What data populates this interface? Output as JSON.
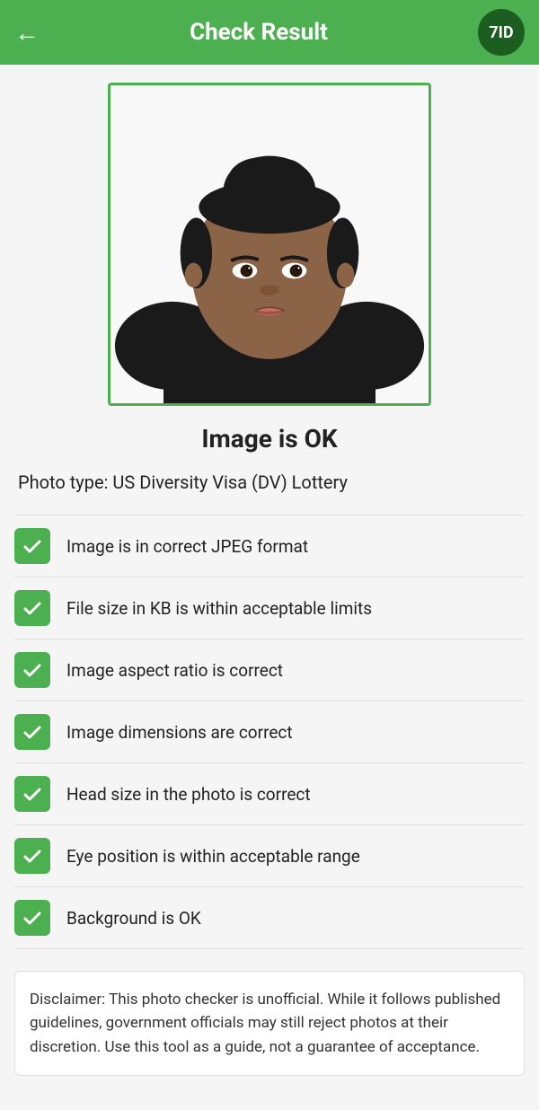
{
  "header": {
    "title": "Check Result",
    "back_icon": "←",
    "logo_text": "7ID"
  },
  "status": {
    "label": "Image is OK"
  },
  "photo_type": {
    "label": "Photo type: US Diversity Visa (DV) Lottery"
  },
  "checks": [
    {
      "id": 1,
      "label": "Image is in correct JPEG format",
      "passed": true
    },
    {
      "id": 2,
      "label": "File size in KB is within acceptable limits",
      "passed": true
    },
    {
      "id": 3,
      "label": "Image aspect ratio is correct",
      "passed": true
    },
    {
      "id": 4,
      "label": "Image dimensions are correct",
      "passed": true
    },
    {
      "id": 5,
      "label": "Head size in the photo is correct",
      "passed": true
    },
    {
      "id": 6,
      "label": "Eye position is within acceptable range",
      "passed": true
    },
    {
      "id": 7,
      "label": "Background is OK",
      "passed": true
    }
  ],
  "disclaimer": {
    "text": "Disclaimer: This photo checker is unofficial. While it follows published guidelines, government officials may still reject photos at their discretion. Use this tool as a guide, not a guarantee of acceptance."
  },
  "colors": {
    "header_bg": "#4caf50",
    "check_bg": "#4caf50",
    "logo_bg": "#1b5e20"
  }
}
